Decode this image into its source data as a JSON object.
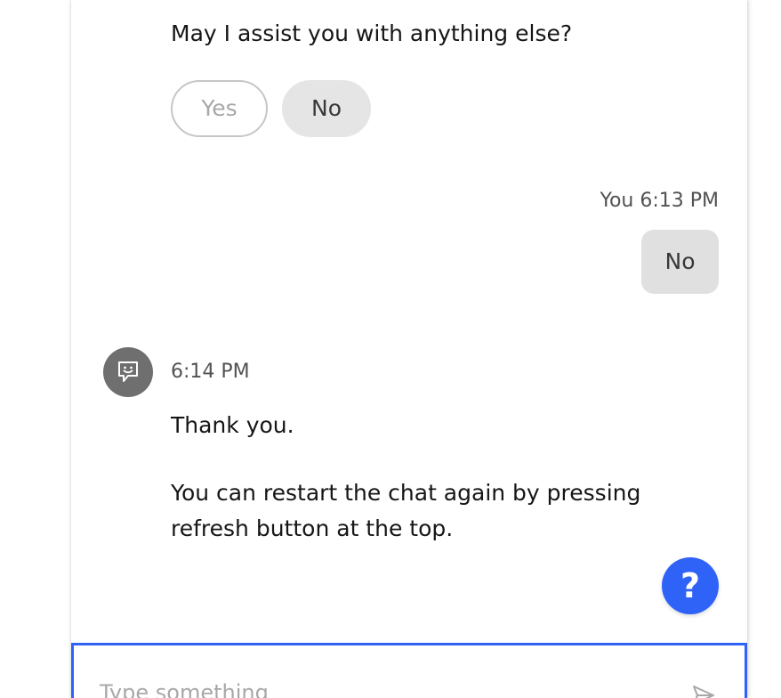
{
  "conversation": {
    "prompt": "May I assist you with anything else?",
    "options": {
      "yes_label": "Yes",
      "no_label": "No"
    },
    "user_message": {
      "meta": "You 6:13 PM",
      "text": "No"
    },
    "bot_message": {
      "avatar_icon": "chatbot-face-icon",
      "time": "6:14 PM",
      "line1": "Thank you.",
      "line2": "You can restart the chat again by pressing refresh button at the top."
    }
  },
  "help_button": {
    "label": "?",
    "color": "#2f62f7"
  },
  "composer": {
    "placeholder": "Type something",
    "value": "",
    "send_icon": "send-icon",
    "focus_color": "#2f62f7"
  }
}
